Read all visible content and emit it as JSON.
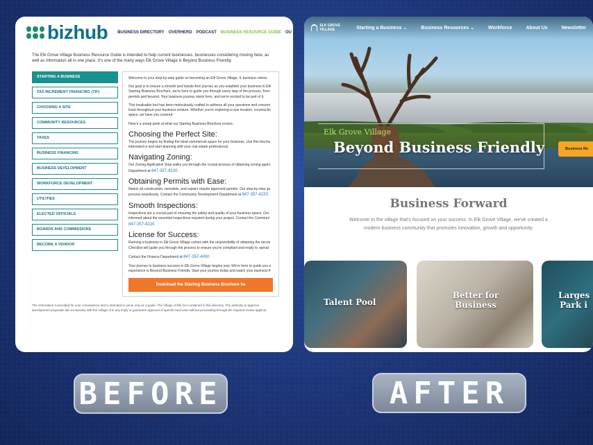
{
  "before": {
    "logo": "bizhub",
    "nav": [
      "BUSINESS DIRECTORY",
      "OVERHERD",
      "PODCAST",
      "BUSINESS RESOURCE GUIDE",
      "OU"
    ],
    "nav_active_index": 3,
    "intro": "The Elk Grove Village Business Resource Guide is intended to help current businesses, businesses considering moving here, as well as information all in one place. It's one of the many ways Elk Grove Village is Beyond Business Friendly.",
    "sidebar": [
      "STARTING A BUSINESS",
      "TAX INCREMENT FINANCING (TIF)",
      "CHOOSING A SITE",
      "COMMUNITY RESOURCES",
      "TAXES",
      "BUSINESS FINANCING",
      "BUSINESS DEVELOPMENT",
      "WORKFORCE DEVELOPMENT",
      "UTILITIES",
      "ELECTED OFFICIALS",
      "BOARDS AND COMMISSIONS",
      "BECOME A VENDOR"
    ],
    "content": {
      "p1": "Welcome to your step-by-step guide on becoming an Elk Grove Village, IL business owner.",
      "p2": "Our goal is to ensure a smooth and hassle-free journey as you establish your business in Elk Starting Business Brochure, we're here to guide you through every step of the process, from permits and beyond. Your business journey starts here, and we're excited to be part of it.",
      "p3": "This invaluable tool has been meticulously crafted to address all your questions and concern track throughout your business venture. Whether you're exploring a new location, constructio space, we have you covered.",
      "p4": "Here's a sneak peek at what our Starting Business Brochure covers:",
      "h1": "Choosing the Perfect Site:",
      "h1_text": "The journey begins by finding the ideal commercial space for your business. Use this brochu interested in and start planning with your real estate professional.",
      "h2": "Navigating Zoning:",
      "h2_text": "Our Zoning Application Step walks you through the crucial process of obtaining zoning appro Department at",
      "h2_phone": "847-357-4220.",
      "h3": "Obtaining Permits with Ease:",
      "h3_text": "Nearly all construction, remodels, and repairs require approved permits. Our step-by-step gu process seamlessly. Contact the Community Development Department at",
      "h3_phone": "847-357-4220.",
      "h4": "Smooth Inspections:",
      "h4_text": "Inspections are a crucial part of ensuring the safety and quality of your business space. Our informed about the essential inspections required during your project. Contact the Communi",
      "h4_phone": "847-357-4220.",
      "h5": "License for Success:",
      "h5_text": "Running a business in Elk Grove Village comes with the responsibility of obtaining the neces Checklist will guide you through the process to ensure you're compliant and ready to operat",
      "finance_text": "Contact the Finance Department at",
      "finance_phone": "847-357-4000",
      "closing": "Your journey to business success in Elk Grove Village begins now. We're here to guide you e experience is Beyond Business Friendly. Start your journey today and watch your business fl",
      "cta": "Download the Starting Business Brochure he"
    },
    "footer": "The information is provided for your convenience and is intended to serve only as a guide. The Village of Elk Gro contained in this directory. The authority to approve development proposals lies exclusively with the Village of E any imply or guarantee approval of specific land uses without proceeding through the required review applicat"
  },
  "after": {
    "logo": "ELK GROVE VILLAGE",
    "nav": [
      "Starting a Business ⌄",
      "Business Resources ⌄",
      "Workforce",
      "About Us",
      "Newsletter"
    ],
    "eyebrow": "Elk Grove Village",
    "hero_title": "Beyond Business Friendly",
    "hero_cta": "Business Re",
    "forward_title": "Business Forward",
    "forward_text": "Welcome to the village that's focused on your success. In Elk Grove Village, we've created a modern business community that promotes innovation, growth and opportunity.",
    "cards": [
      "Talent Pool",
      "Better for Business",
      "Larges Park i"
    ]
  },
  "labels": {
    "before": "BEFORE",
    "after": "AFTER"
  },
  "colors": {
    "bizhub_teal": "#18928e",
    "bizhub_orange": "#f0772a",
    "after_gold": "#f6a623",
    "after_green": "#b6e46a",
    "background_blue": "#1d3679"
  }
}
